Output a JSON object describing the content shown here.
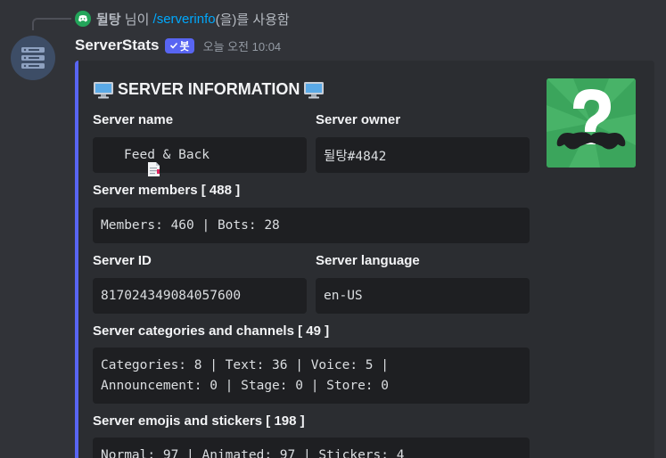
{
  "reply": {
    "username": "뒬탕",
    "suffix": " 님이 ",
    "command": "/serverinfo",
    "after": "(을)를 사용함"
  },
  "header": {
    "bot_name": "ServerStats",
    "bot_tag": "봇",
    "timestamp": "오늘 오전 10:04"
  },
  "embed": {
    "title": "SERVER INFORMATION",
    "accent_color": "#5865f2",
    "fields": {
      "server_name_label": "Server name",
      "server_name_value": "Feed & Back",
      "server_owner_label": "Server owner",
      "server_owner_value": "뒬탕#4842",
      "members_label": "Server members [ 488 ]",
      "members_value": "Members: 460 | Bots: 28",
      "server_id_label": "Server ID",
      "server_id_value": "817024349084057600",
      "language_label": "Server language",
      "language_value": "en-US",
      "channels_label": "Server categories and channels [ 49 ]",
      "channels_line1": "Categories: 8 | Text: 36 | Voice: 5 |",
      "channels_line2": "Announcement: 0 | Stage: 0 | Store: 0",
      "emojis_label": "Server emojis and stickers [ 198 ]",
      "emojis_value": "Normal: 97 | Animated: 97 | Stickers: 4"
    }
  },
  "icons": {
    "reply_icon": "discord-icon",
    "title_icon": "desktop-computer-icon",
    "server_name_icon": "document-icon",
    "thumbnail": "question-mark-mustache-icon"
  }
}
